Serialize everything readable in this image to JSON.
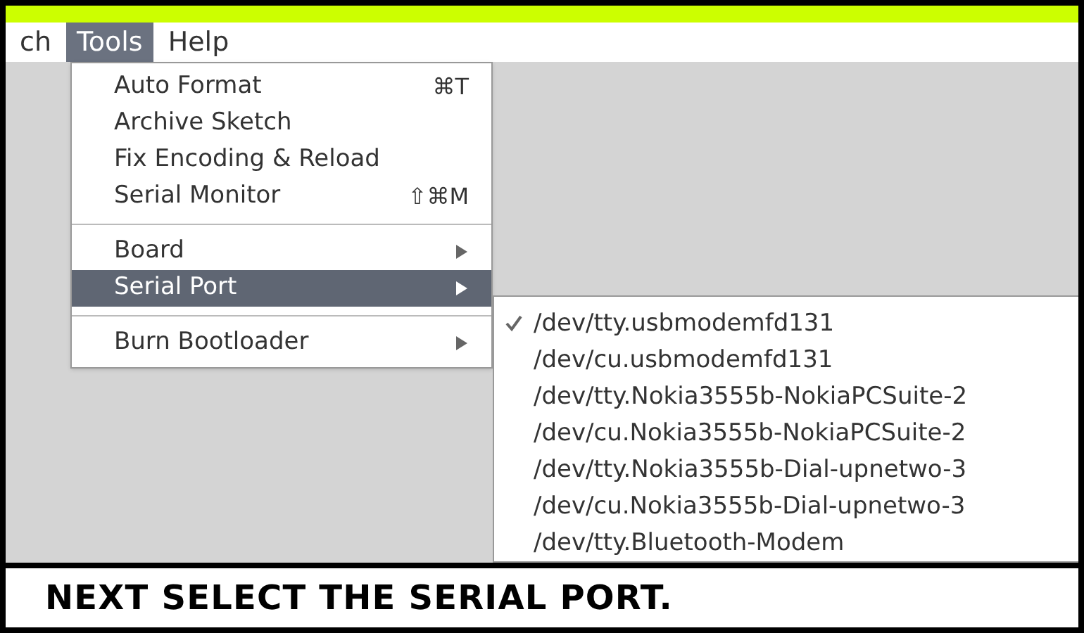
{
  "menubar": [
    {
      "label": "ch",
      "selected": false
    },
    {
      "label": "Tools",
      "selected": true
    },
    {
      "label": "Help",
      "selected": false
    }
  ],
  "menu": [
    {
      "kind": "item",
      "label": "Auto Format",
      "shortcut": "⌘T",
      "submenu": false,
      "selected": false
    },
    {
      "kind": "item",
      "label": "Archive Sketch",
      "submenu": false,
      "selected": false
    },
    {
      "kind": "item",
      "label": "Fix Encoding & Reload",
      "submenu": false,
      "selected": false
    },
    {
      "kind": "item",
      "label": "Serial Monitor",
      "shortcut": "⇧⌘M",
      "submenu": false,
      "selected": false
    },
    {
      "kind": "separator"
    },
    {
      "kind": "item",
      "label": "Board",
      "submenu": true,
      "selected": false
    },
    {
      "kind": "item",
      "label": "Serial Port",
      "submenu": true,
      "selected": true
    },
    {
      "kind": "separator"
    },
    {
      "kind": "item",
      "label": "Burn Bootloader",
      "submenu": true,
      "selected": false
    }
  ],
  "ports": [
    {
      "label": "/dev/tty.usbmodemfd131",
      "checked": true
    },
    {
      "label": "/dev/cu.usbmodemfd131",
      "checked": false
    },
    {
      "label": "/dev/tty.Nokia3555b-NokiaPCSuite-2",
      "checked": false
    },
    {
      "label": "/dev/cu.Nokia3555b-NokiaPCSuite-2",
      "checked": false
    },
    {
      "label": "/dev/tty.Nokia3555b-Dial-upnetwo-3",
      "checked": false
    },
    {
      "label": "/dev/cu.Nokia3555b-Dial-upnetwo-3",
      "checked": false
    },
    {
      "label": "/dev/tty.Bluetooth-Modem",
      "checked": false
    }
  ],
  "caption": "NEXT SELECT THE SERIAL PORT."
}
